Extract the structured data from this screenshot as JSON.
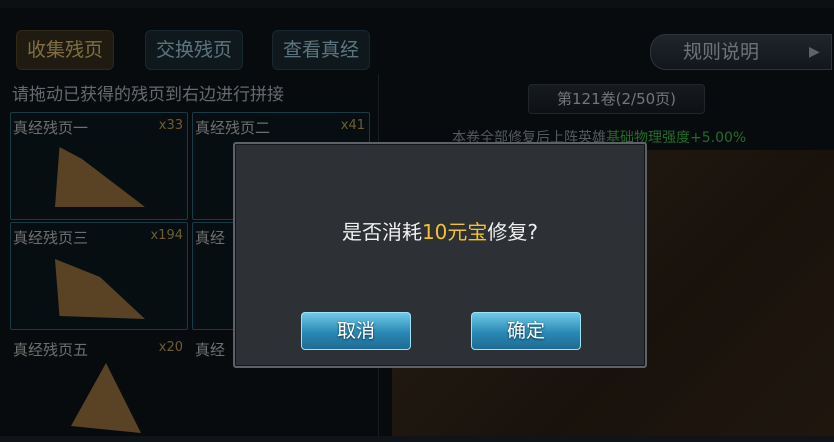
{
  "tabs": [
    {
      "label": "收集残页",
      "active": true
    },
    {
      "label": "交换残页",
      "active": false
    },
    {
      "label": "查看真经",
      "active": false
    }
  ],
  "rules_label": "规则说明",
  "hint": "请拖动已获得的残页到右边进行拼接",
  "slots": [
    {
      "name": "真经残页一",
      "count": "x33"
    },
    {
      "name": "真经残页二",
      "count": "x41"
    },
    {
      "name": "真经残页三",
      "count": "x194"
    },
    {
      "name": "真经",
      "count": ""
    },
    {
      "name": "真经残页五",
      "count": "x20"
    },
    {
      "name": "真经",
      "count": ""
    }
  ],
  "volume": "第121卷(2/50页)",
  "bonus": {
    "prefix": "本卷全部修复后上阵英雄",
    "value": "基础物理强度+5.00%"
  },
  "dialog": {
    "msg_prefix": "是否消耗",
    "msg_highlight": "10元宝",
    "msg_suffix": "修复?",
    "cancel_label": "取消",
    "ok_label": "确定"
  },
  "colors": {
    "highlight": "#f2c230",
    "bonus_green": "#3cc24a",
    "button_blue": "#2a88b4"
  }
}
